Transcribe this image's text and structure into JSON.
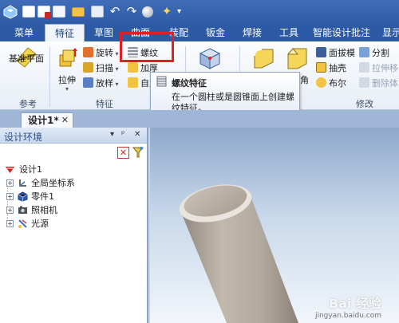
{
  "quick_access": {
    "icons": [
      "app-logo-icon",
      "new-file-icon",
      "close-file-icon",
      "document-icon",
      "open-folder-icon",
      "save-icon",
      "undo-icon",
      "redo-icon",
      "sphere-icon",
      "sparkle-icon",
      "customize-icon"
    ]
  },
  "tabs": [
    "菜单",
    "特征",
    "草图",
    "曲面",
    "装配",
    "钣金",
    "焊接",
    "工具",
    "智能设计批注",
    "显示"
  ],
  "active_tab": "特征",
  "ribbon": {
    "groups": {
      "reference": {
        "label": "参考",
        "button": "基准平面"
      },
      "feature": {
        "label": "特征",
        "extrude": "拉伸",
        "revolve": "旋转",
        "sweep": "扫描",
        "loft": "放样",
        "thread": "螺纹",
        "thicken": "加厚",
        "custom": "自定"
      },
      "modify": {
        "label": "修改",
        "chamfer_label": "角",
        "draft": "面拔模",
        "shell": "抽壳",
        "boolean": "布尔",
        "split": "分割",
        "pull_move": "拉伸移",
        "delete_body": "删除体"
      }
    }
  },
  "tooltip": {
    "title": "螺纹特征",
    "description": "在一个圆柱或是圆锥面上创建螺纹特征。"
  },
  "document_tab": {
    "label": "设计1*",
    "close": "✕"
  },
  "panel": {
    "title": "设计环境",
    "controls": [
      "▾",
      "ᵖ",
      "✕"
    ],
    "tree": [
      {
        "label": "设计1",
        "icon": "design-icon"
      },
      {
        "label": "全局坐标系",
        "icon": "axis-icon"
      },
      {
        "label": "零件1",
        "icon": "part-icon"
      },
      {
        "label": "照相机",
        "icon": "camera-icon"
      },
      {
        "label": "光源",
        "icon": "light-icon"
      }
    ]
  },
  "watermark": {
    "line1": "Bai 经验",
    "line2": "jingyan.baidu.com"
  },
  "colors": {
    "highlight": "#e31e24",
    "tab_bar": "#2d5aa4",
    "cylinder": "#b9b0a6"
  }
}
